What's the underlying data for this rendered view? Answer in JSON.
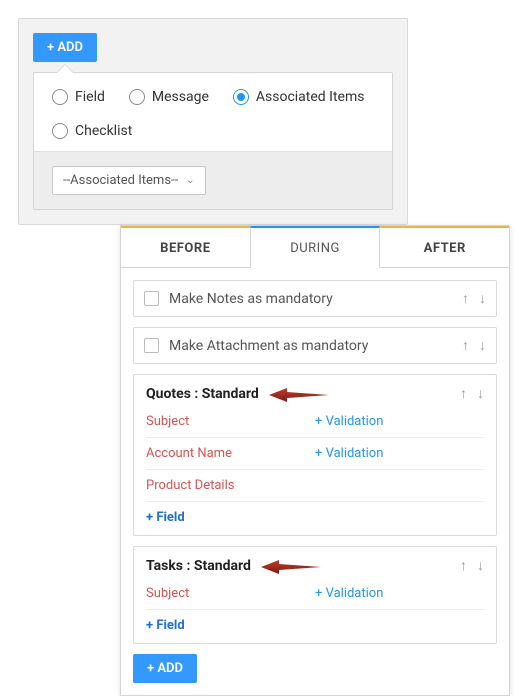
{
  "panel1": {
    "add_label": "+ ADD",
    "radios": {
      "field": "Field",
      "message": "Message",
      "associated": "Associated Items",
      "checklist": "Checklist",
      "selected": "associated"
    },
    "select_placeholder": "--Associated Items--"
  },
  "panel2": {
    "tabs": {
      "before": "BEFORE",
      "during": "DURING",
      "after": "AFTER"
    },
    "cbox1": "Make Notes as mandatory",
    "cbox2": "Make Attachment as mandatory",
    "group1": {
      "title": "Quotes : Standard",
      "fields": {
        "f0": {
          "label": "Subject",
          "validation": "+ Validation"
        },
        "f1": {
          "label": "Account Name",
          "validation": "+ Validation"
        },
        "f2": {
          "label": "Product Details",
          "validation": ""
        }
      },
      "add_field": "+ Field"
    },
    "group2": {
      "title": "Tasks : Standard",
      "fields": {
        "f0": {
          "label": "Subject",
          "validation": "+ Validation"
        }
      },
      "add_field": "+ Field"
    },
    "add_label": "+ ADD",
    "arrows": {
      "up": "↑",
      "down": "↓"
    }
  }
}
